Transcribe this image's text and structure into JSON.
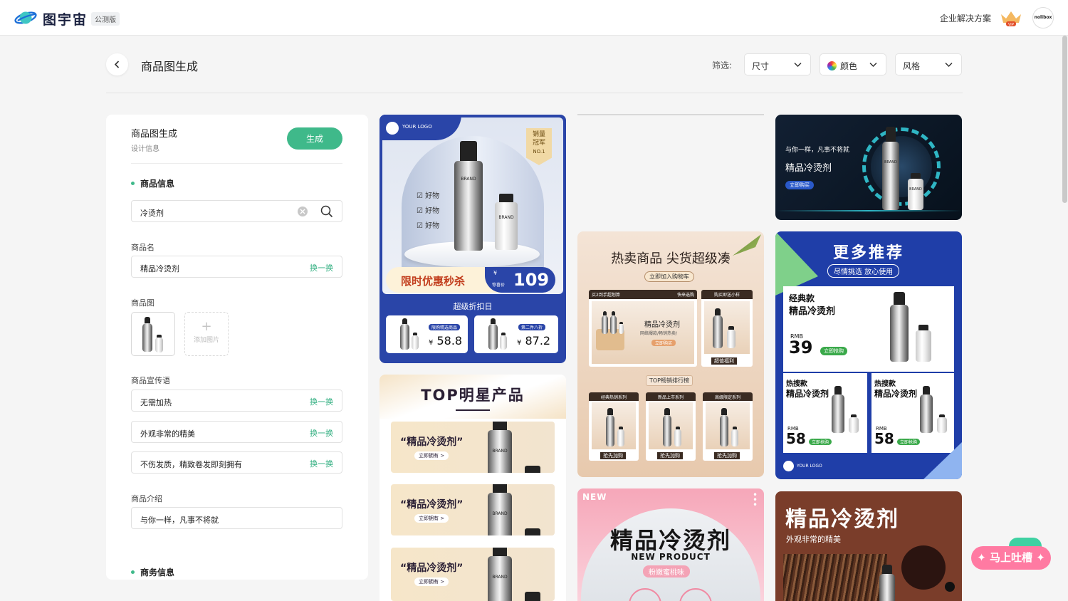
{
  "header": {
    "brand": "图宇宙",
    "beta_tag": "公测版",
    "enterprise_link": "企业解决方案",
    "vip_badge": "VIP",
    "avatar_text": "nolibox"
  },
  "toolbar": {
    "page_title": "商品图生成",
    "filter_label": "筛选:",
    "filters": [
      {
        "label": "尺寸"
      },
      {
        "label": "颜色"
      },
      {
        "label": "风格"
      }
    ]
  },
  "form": {
    "title": "商品图生成",
    "subtitle": "设计信息",
    "generate_label": "生成",
    "section_product": "商品信息",
    "search_value": "冷烫剂",
    "name_label": "商品名",
    "name_value": "精品冷烫剂",
    "swap_label": "换一换",
    "image_label": "商品图",
    "add_image_label": "添加图片",
    "slogan_label": "商品宣传语",
    "slogans": [
      "无需加热",
      "外观非常的精美",
      "不伤发质，精致卷发即刻拥有"
    ],
    "intro_label": "商品介绍",
    "intro_value": "与你一样，凡事不将就",
    "section_business": "商务信息"
  },
  "cards": {
    "c1": {
      "logo": "YOUR LOGO",
      "badge": [
        "销量",
        "冠军",
        "NO.1"
      ],
      "checks": [
        "好物",
        "好物",
        "好物"
      ],
      "brand": "BRAND",
      "promo": "限时优惠秒杀",
      "price_prefix": "¥",
      "price_sub": "惊喜价",
      "price": "109",
      "subtitle": "超级折扣日",
      "item1_price": "58.8",
      "item2_price": "87.2",
      "tag1": "限购精选商品",
      "tag2": "第二件八折",
      "currency": "¥"
    },
    "c2": {
      "title": "TOP明星产品",
      "row_title": "“精品冷烫剂”",
      "row_btn": "立即拥有 >",
      "brand": "BRAND"
    },
    "c3": {
      "title": "热卖商品 尖货超级凑",
      "sub": "立即加入购物车",
      "tab_left": "买2到手超划算",
      "tab_mid": "快来选购",
      "tab_right": "购买即送小样",
      "product": "精品冷烫剂",
      "product_sub": "网络爆款/畅销热卖/",
      "buy": "立即购买",
      "gift": "超值福利",
      "rank": "TOP畅销排行榜",
      "series": [
        "经典热销系列",
        "新品上市系列",
        "高级限定系列"
      ],
      "snap": "抢先加购"
    },
    "c4": {
      "line1": "与你一样，凡事不将就",
      "line2": "精品冷烫剂",
      "btn": "立即购买",
      "brand": "BRAND"
    },
    "c5": {
      "title": "更多推荐",
      "sub": "尽情挑选 放心使用",
      "tag": "经典款",
      "product": "精品冷烫剂",
      "rmb": "RMB",
      "price": "39",
      "btn": "立即抢购",
      "hot": "热搜款",
      "price2": "58",
      "logo": "YOUR LOGO"
    },
    "c6": {
      "new": "NEW",
      "title": "精品冷烫剂",
      "sub": "NEW PRODUCT",
      "flavor": "粉嫩蜜桃味"
    },
    "c7": {
      "title": "精品冷烫剂",
      "sub": "外观非常的精美"
    }
  },
  "feedback": {
    "label": "马上吐槽"
  },
  "colors": {
    "accent": "#3fb98a",
    "card_blue": "#2a45a8",
    "royal": "#1f3ea8",
    "dark": "#0d1b2a"
  }
}
